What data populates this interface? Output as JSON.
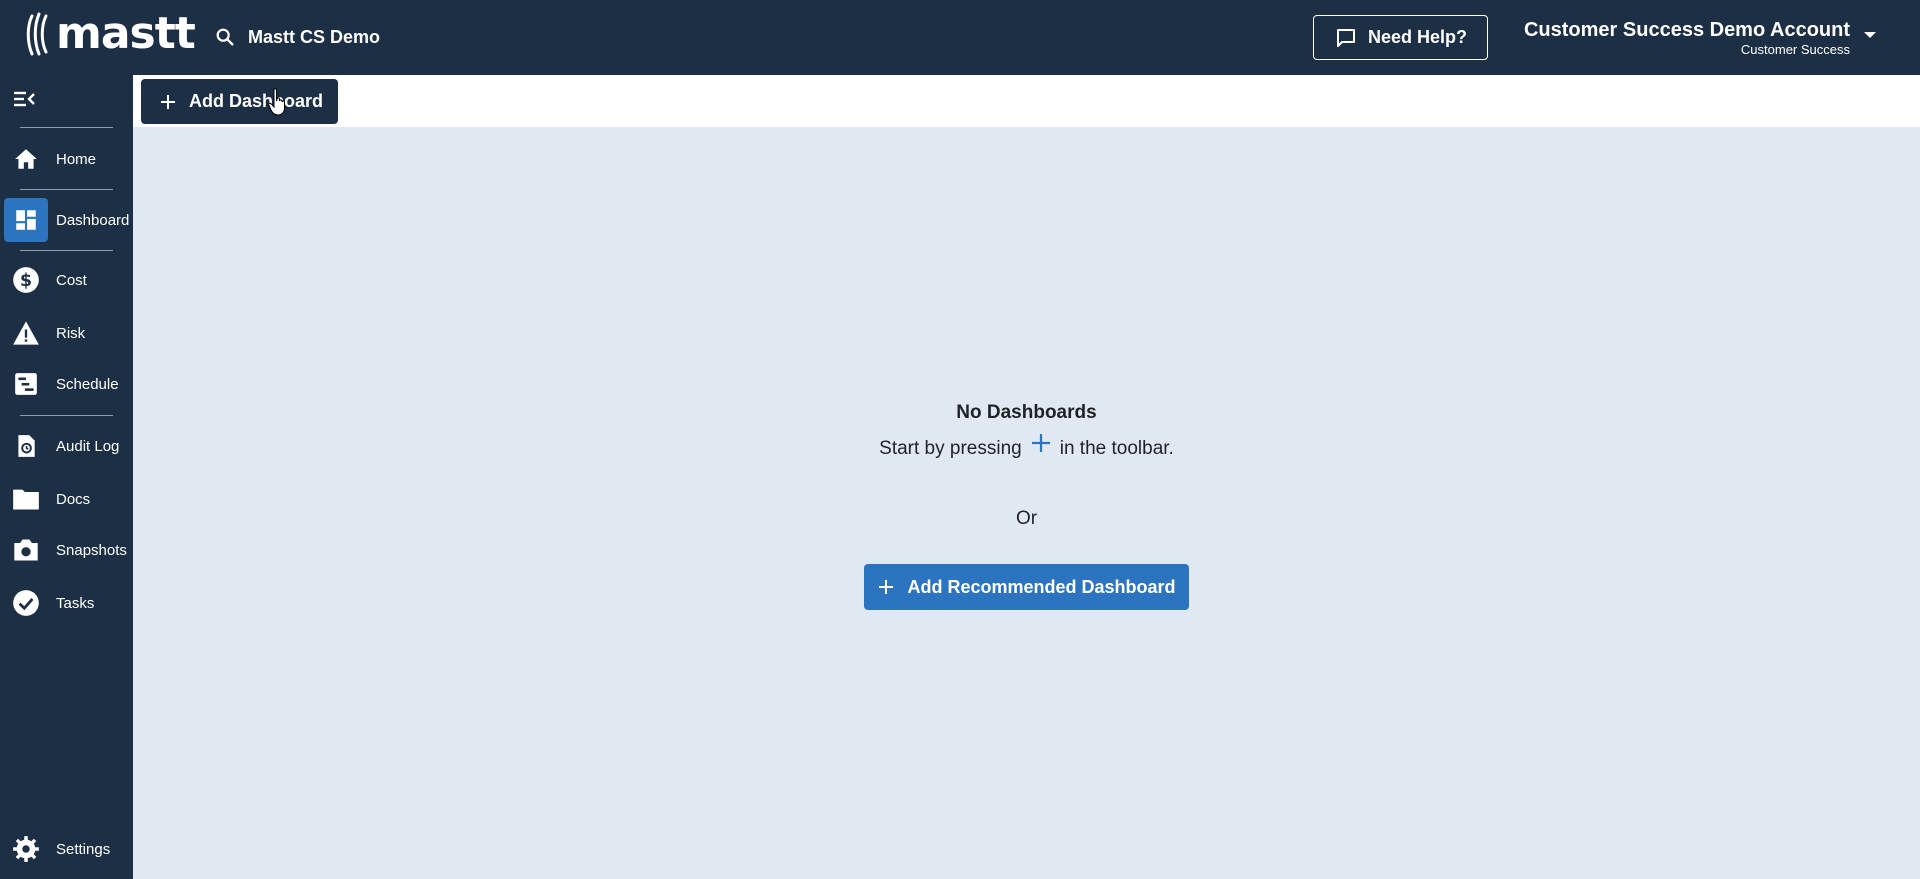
{
  "app": {
    "logo_text": "mastt",
    "project_name": "Mastt CS Demo",
    "help_label": "Need Help?",
    "account_name": "Customer Success Demo Account",
    "account_role": "Customer Success"
  },
  "sidebar": {
    "items": [
      {
        "label": "Home",
        "icon": "home-icon"
      },
      {
        "label": "Dashboard",
        "icon": "dashboard-icon",
        "active": true
      },
      {
        "label": "Cost",
        "icon": "dollar-icon"
      },
      {
        "label": "Risk",
        "icon": "warning-icon"
      },
      {
        "label": "Schedule",
        "icon": "schedule-icon"
      },
      {
        "label": "Audit Log",
        "icon": "audit-log-icon"
      },
      {
        "label": "Docs",
        "icon": "folder-icon"
      },
      {
        "label": "Snapshots",
        "icon": "camera-icon"
      },
      {
        "label": "Tasks",
        "icon": "check-circle-icon"
      },
      {
        "label": "Settings",
        "icon": "gear-icon"
      }
    ]
  },
  "toolbar": {
    "add_dashboard_label": "Add Dashboard"
  },
  "empty_state": {
    "title": "No Dashboards",
    "line_before": "Start by pressing",
    "line_after": "in the toolbar.",
    "or_text": "Or",
    "recommended_label": "Add Recommended Dashboard"
  },
  "colors": {
    "nav_bg": "#1c2f45",
    "accent": "#2d74c0",
    "content_bg": "#e0e8f1"
  }
}
